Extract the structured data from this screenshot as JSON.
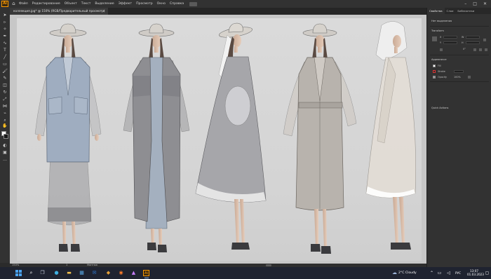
{
  "app": {
    "logo": "Ai"
  },
  "menu": {
    "items": [
      "Файл",
      "Редактирование",
      "Объект",
      "Текст",
      "Выделение",
      "Эффект",
      "Просмотр",
      "Окно",
      "Справка"
    ]
  },
  "document": {
    "tab_title": "коллекция.jpg* @ 150% (RGB/Предварительный просмотр)"
  },
  "status": {
    "zoom": "150%",
    "page": "1",
    "mode": "Монтаж"
  },
  "panel": {
    "tabs": [
      "Свойства",
      "Слои",
      "Библиотеки"
    ],
    "no_selection": "Нет выделения",
    "transform": "Transform",
    "x_label": "X",
    "y_label": "Y",
    "w_label": "W",
    "h_label": "H",
    "angle_value": "0°",
    "appearance": "Appearance",
    "fill_label": "Fill",
    "stroke_label": "Stroke",
    "opacity_label": "Opacity",
    "opacity_value": "100%",
    "quick_actions": "Quick Actions"
  },
  "taskbar": {
    "weather": "2°C Cloudy",
    "lang": "РУС",
    "time": "13:07",
    "date": "01.03.2023"
  },
  "colors": {
    "accent": "#ff9a00",
    "canvas": "#c7c7c7",
    "taskbar": "#1f2330"
  },
  "icons": [
    "home-icon",
    "search-icon",
    "task-view-icon",
    "edge-icon",
    "file-explorer-icon",
    "store-icon",
    "mail-icon",
    "illustrator-icon",
    "photos-icon",
    "weather-icon",
    "volume-icon",
    "network-icon",
    "close-icon",
    "minimize-icon",
    "maximize-icon"
  ]
}
